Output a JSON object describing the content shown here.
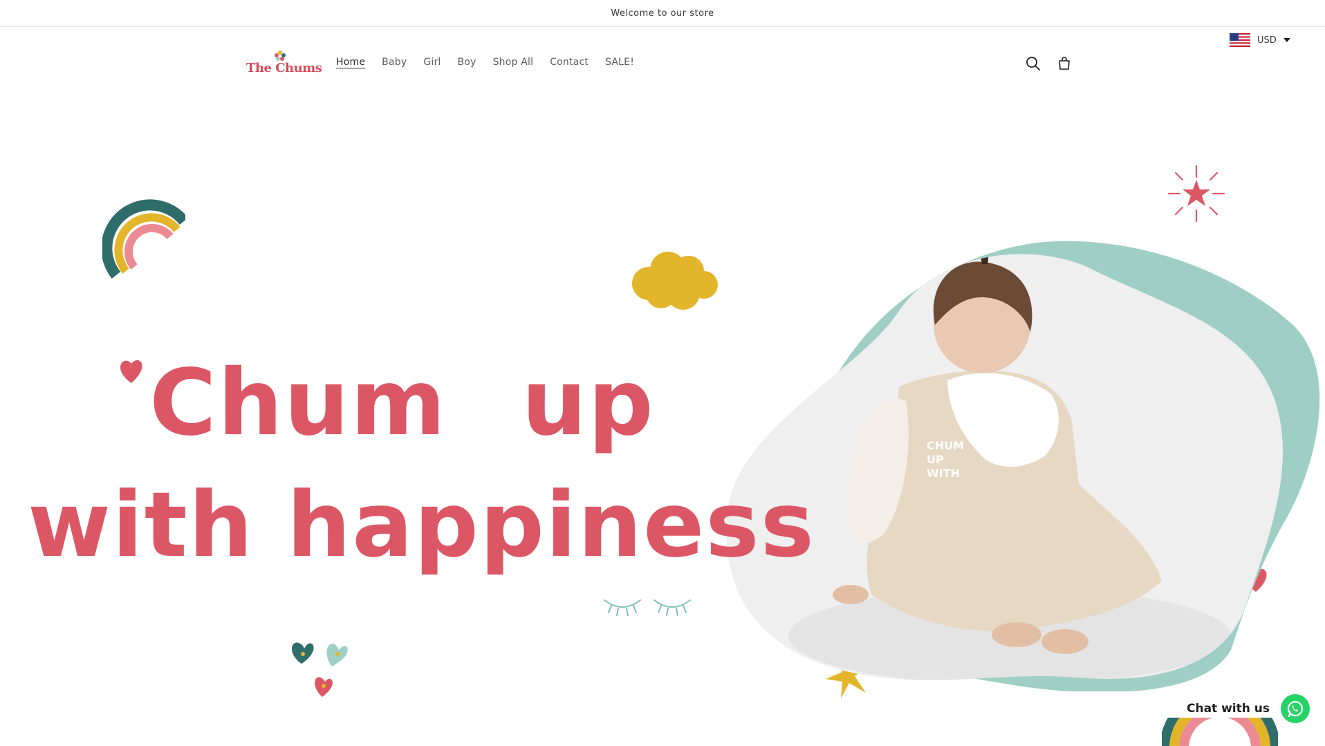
{
  "announcement": {
    "text": "Welcome to our store"
  },
  "header": {
    "logo_text": "The Chums",
    "nav": [
      {
        "label": "Home",
        "active": true
      },
      {
        "label": "Baby",
        "active": false
      },
      {
        "label": "Girl",
        "active": false
      },
      {
        "label": "Boy",
        "active": false
      },
      {
        "label": "Shop All",
        "active": false
      },
      {
        "label": "Contact",
        "active": false
      },
      {
        "label": "SALE!",
        "active": false
      }
    ],
    "icons": {
      "search": "search-icon",
      "cart": "cart-icon"
    },
    "currency": {
      "code": "USD",
      "flag": "us-flag-icon"
    }
  },
  "hero": {
    "line1": "Chum up",
    "line2": "with happiness",
    "image_alt": "Toddler in beige dress sitting"
  },
  "chat": {
    "label": "Chat with us",
    "icon": "whatsapp-icon"
  },
  "colors": {
    "brand_pink": "#dc5765",
    "teal": "#9fcfc4",
    "mustard": "#e3b52a",
    "dark_teal": "#2f6d6a",
    "whatsapp": "#25d366"
  }
}
